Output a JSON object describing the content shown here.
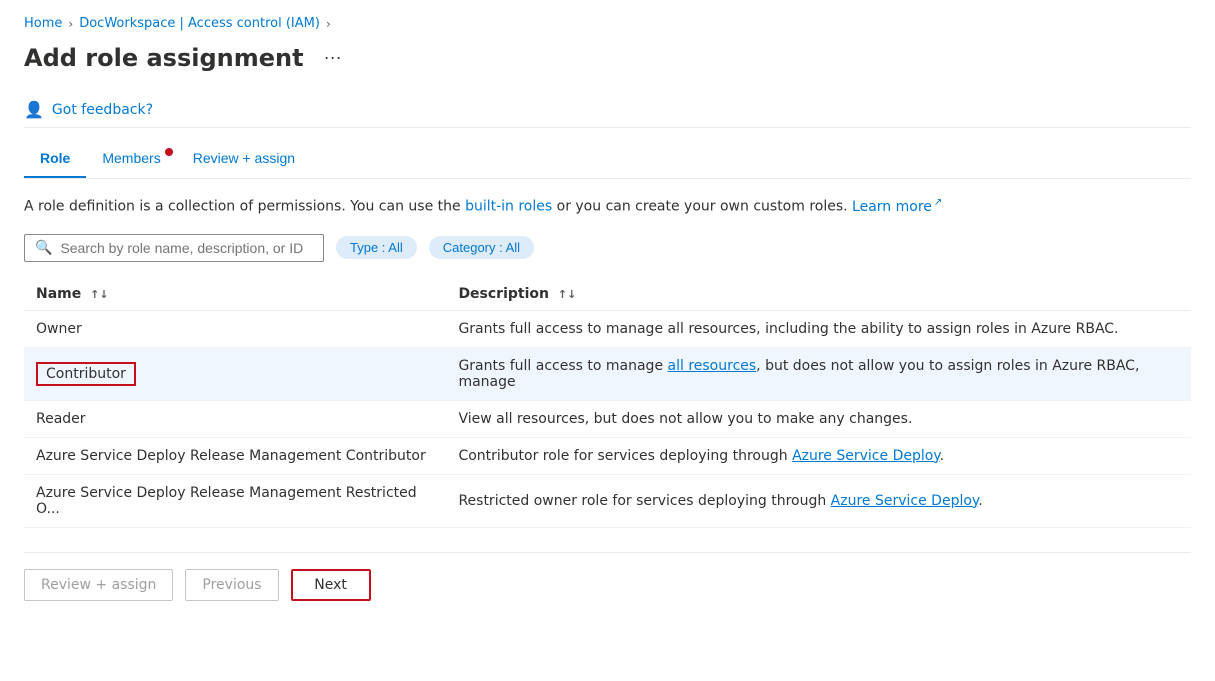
{
  "breadcrumb": {
    "items": [
      {
        "label": "Home",
        "href": "#"
      },
      {
        "label": "DocWorkspace | Access control (IAM)",
        "href": "#"
      }
    ],
    "current": "Add role assignment"
  },
  "page": {
    "title": "Add role assignment",
    "more_label": "···"
  },
  "feedback": {
    "link_label": "Got feedback?"
  },
  "tabs": [
    {
      "label": "Role",
      "active": true,
      "has_badge": false
    },
    {
      "label": "Members",
      "active": false,
      "has_badge": true
    },
    {
      "label": "Review + assign",
      "active": false,
      "has_badge": false
    }
  ],
  "description": {
    "text_before": "A role definition is a collection of permissions. You can use the ",
    "link1": "built-in roles",
    "text_middle": " or you can create your own custom roles. ",
    "link2": "Learn more",
    "ext_icon": "↗"
  },
  "search": {
    "placeholder": "Search by role name, description, or ID"
  },
  "filters": [
    {
      "label": "Type : All"
    },
    {
      "label": "Category : All"
    }
  ],
  "table": {
    "columns": [
      {
        "label": "Name",
        "sortable": true
      },
      {
        "label": "Description",
        "sortable": true
      }
    ],
    "rows": [
      {
        "name": "Owner",
        "description": "Grants full access to manage all resources, including the ability to assign roles in Azure RBAC.",
        "desc_has_link": false,
        "selected": false
      },
      {
        "name": "Contributor",
        "description_parts": [
          {
            "text": "Grants full access to manage ",
            "type": "plain"
          },
          {
            "text": "all resources",
            "type": "link"
          },
          {
            "text": ", but does not allow you to assign roles in Azure RBAC, manage",
            "type": "plain"
          }
        ],
        "selected": true
      },
      {
        "name": "Reader",
        "description": "View all resources, but does not allow you to make any changes.",
        "desc_has_link": false,
        "selected": false
      },
      {
        "name": "Azure Service Deploy Release Management Contributor",
        "description_parts": [
          {
            "text": "Contributor role for services deploying through ",
            "type": "plain"
          },
          {
            "text": "Azure Service Deploy",
            "type": "link"
          },
          {
            "text": ".",
            "type": "plain"
          }
        ],
        "selected": false
      },
      {
        "name": "Azure Service Deploy Release Management Restricted O...",
        "description_parts": [
          {
            "text": "Restricted owner role for services deploying through ",
            "type": "plain"
          },
          {
            "text": "Azure Service Deploy",
            "type": "link"
          },
          {
            "text": ".",
            "type": "plain"
          }
        ],
        "selected": false
      }
    ]
  },
  "footer": {
    "review_assign_label": "Review + assign",
    "previous_label": "Previous",
    "next_label": "Next"
  }
}
